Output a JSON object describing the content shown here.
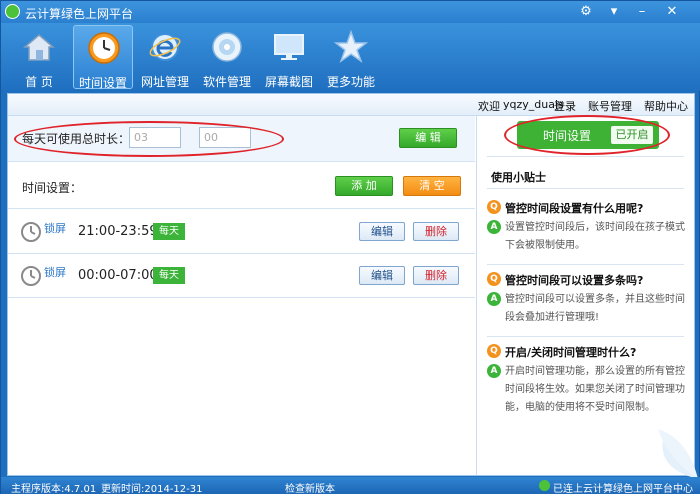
{
  "window": {
    "title": "云计算绿色上网平台"
  },
  "nav": [
    {
      "label": "首   页"
    },
    {
      "label": "时间设置"
    },
    {
      "label": "网址管理"
    },
    {
      "label": "软件管理"
    },
    {
      "label": "屏幕截图"
    },
    {
      "label": "更多功能"
    }
  ],
  "userbar": {
    "welcome": "欢迎",
    "username": "yqzy_duajs",
    "login": "登录",
    "account": "账号管理",
    "help": "帮助中心"
  },
  "daily": {
    "label": "每天可使用总时长：",
    "hours_placeholder": "03",
    "minutes_placeholder": "00",
    "edit_label": "编 辑"
  },
  "settings": {
    "label": "时间设置：",
    "add_label": "添 加",
    "clear_label": "清 空"
  },
  "rules": [
    {
      "type": "锁屏",
      "time": "21:00-23:59",
      "repeat": "每天",
      "edit": "编辑",
      "delete": "删除"
    },
    {
      "type": "锁屏",
      "time": "00:00-07:00",
      "repeat": "每天",
      "edit": "编辑",
      "delete": "删除"
    }
  ],
  "toggle": {
    "label": "时间设置",
    "state": "已开启"
  },
  "tips": {
    "title": "使用小贴士",
    "items": [
      {
        "q": "管控时间段设置有什么用呢?",
        "a": "设置管控时间段后，该时间段在孩子模式下会被限制使用。"
      },
      {
        "q": "管控时间段可以设置多条吗?",
        "a": "管控时间段可以设置多条，并且这些时间段会叠加进行管理哦!"
      },
      {
        "q": "开启/关闭时间管理时什么?",
        "a": "开启时间管理功能，那么设置的所有管控时间段将生效。如果您关闭了时间管理功能，电脑的使用将不受时间限制。"
      }
    ]
  },
  "status": {
    "version": "主程序版本:4.7.01",
    "updated": "更新时间:2014-12-31",
    "check": "检查新版本",
    "connected": "已连上云计算绿色上网平台中心"
  },
  "colors": {
    "accent": "#2a7fcf",
    "green": "#3cb43a",
    "orange": "#f28c13",
    "annotation": "#e0232a"
  }
}
